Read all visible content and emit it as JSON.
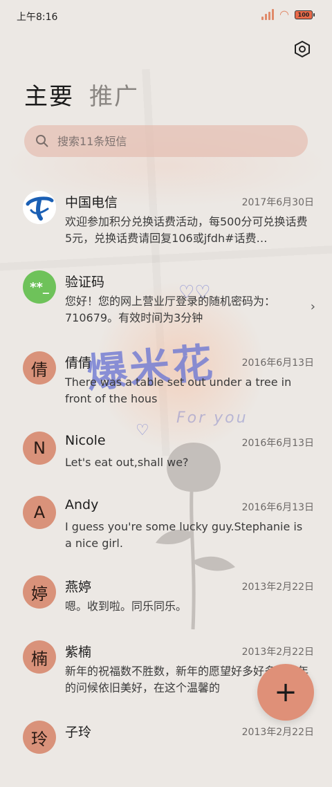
{
  "status_bar": {
    "time": "上午8:16",
    "battery": "100"
  },
  "tabs": [
    {
      "label": "主要",
      "active": true
    },
    {
      "label": "推广",
      "active": false
    }
  ],
  "search": {
    "placeholder": "搜索11条短信"
  },
  "decor": {
    "title": "爆米花",
    "subtitle": "For you"
  },
  "conversations": [
    {
      "avatar": "",
      "avatar_type": "telecom-logo",
      "name": "中国电信",
      "date": "2017年6月30日",
      "preview": "欢迎参加积分兑换话费活动，每500分可兑换话费5元，兑换话费请回复106或jfdh#话费…"
    },
    {
      "avatar": "**_",
      "avatar_type": "code",
      "name": "验证码",
      "date": "",
      "preview": "您好！您的网上营业厅登录的随机密码为：710679。有效时间为3分钟"
    },
    {
      "avatar": "倩",
      "avatar_type": "letter",
      "name": "倩倩",
      "date": "2016年6月13日",
      "preview": "There was a table set out under a tree in front of the hous"
    },
    {
      "avatar": "N",
      "avatar_type": "letter",
      "name": "Nicole",
      "date": "2016年6月13日",
      "preview": "Let's eat out,shall we?"
    },
    {
      "avatar": "A",
      "avatar_type": "letter",
      "name": "Andy",
      "date": "2016年6月13日",
      "preview": "I guess you're some lucky guy.Stephanie is a nice girl."
    },
    {
      "avatar": "婷",
      "avatar_type": "letter",
      "name": "燕婷",
      "date": "2013年2月22日",
      "preview": "嗯。收到啦。同乐同乐。"
    },
    {
      "avatar": "楠",
      "avatar_type": "letter",
      "name": "紫楠",
      "date": "2013年2月22日",
      "preview": "新年的祝福数不胜数，新年的愿望好多好多，新年的问候依旧美好，在这个温馨的"
    },
    {
      "avatar": "玲",
      "avatar_type": "letter",
      "name": "子玲",
      "date": "2013年2月22日",
      "preview": ""
    }
  ],
  "fab": {
    "label": "+"
  },
  "colors": {
    "accent": "#df9078",
    "avatar": "#d9927a",
    "code_avatar": "#6ec25a",
    "telecom_blue": "#1a5fb4"
  }
}
